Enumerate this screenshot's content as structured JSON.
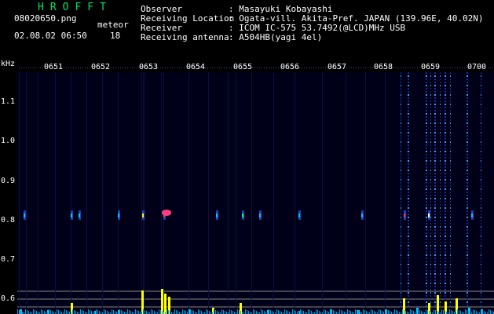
{
  "header": {
    "title": "HROFFT",
    "filename": "08020650.png",
    "meteor_label": "meteor",
    "datetime": "02.08.02 06:50",
    "meteor_count": "18",
    "fields": [
      {
        "label": "Observer",
        "value": ": Masayuki Kobayashi"
      },
      {
        "label": "Receiving Location",
        "value": ": Ogata-vill. Akita-Pref. JAPAN (139.96E, 40.02N)"
      },
      {
        "label": "Receiver",
        "value": ": ICOM IC-575 53.7492(@LCD)MHz USB"
      },
      {
        "label": "Receiving antenna",
        "value": ": A504HB(yagi 4el)"
      }
    ]
  },
  "axis": {
    "unit": "kHz",
    "time_ticks": [
      "0651",
      "0652",
      "0653",
      "0654",
      "0655",
      "0656",
      "0657",
      "0658",
      "0659",
      "0700"
    ],
    "freq_ticks": [
      "1.1",
      "1.0",
      "0.9",
      "0.8",
      "0.7",
      "0.6"
    ]
  },
  "colors": {
    "background": "#000018",
    "title": "#00e060",
    "meteor_bar": "#ffff00",
    "noise": "#00c8ff"
  }
}
